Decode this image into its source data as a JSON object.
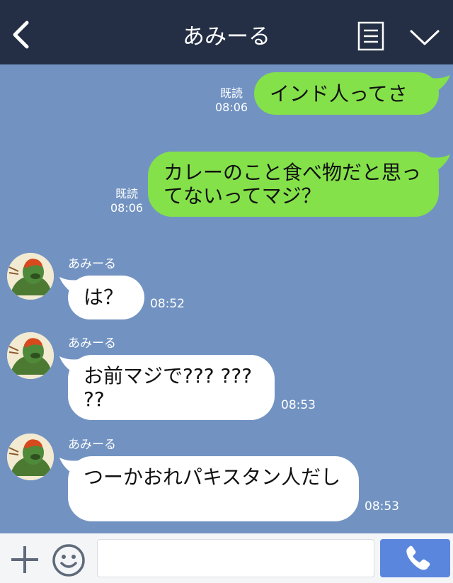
{
  "header": {
    "title": "あみーる",
    "back_icon": "chevron-left-icon",
    "menu_icon": "notes-menu-icon",
    "collapse_icon": "chevron-down-icon"
  },
  "messages": [
    {
      "direction": "sent",
      "text": "インド人ってさ",
      "read": "既読",
      "time": "08:06"
    },
    {
      "direction": "sent",
      "text": "カレーのこと食べ物だと思ってないってマジ？",
      "read": "既読",
      "time": "08:06"
    },
    {
      "direction": "received",
      "sender": "あみーる",
      "text": "は？",
      "time": "08:52"
    },
    {
      "direction": "received",
      "sender": "あみーる",
      "text": "お前マジで??? ??? ??",
      "time": "08:53"
    },
    {
      "direction": "received",
      "sender": "あみーる",
      "text": "つーかおれパキスタン人だし",
      "time": "08:53"
    }
  ],
  "input": {
    "placeholder": "",
    "value": ""
  },
  "colors": {
    "header_bg": "#242f45",
    "chat_bg": "#7293c2",
    "sent_bubble": "#84e14a",
    "received_bubble": "#ffffff",
    "call_button": "#5a86de"
  }
}
